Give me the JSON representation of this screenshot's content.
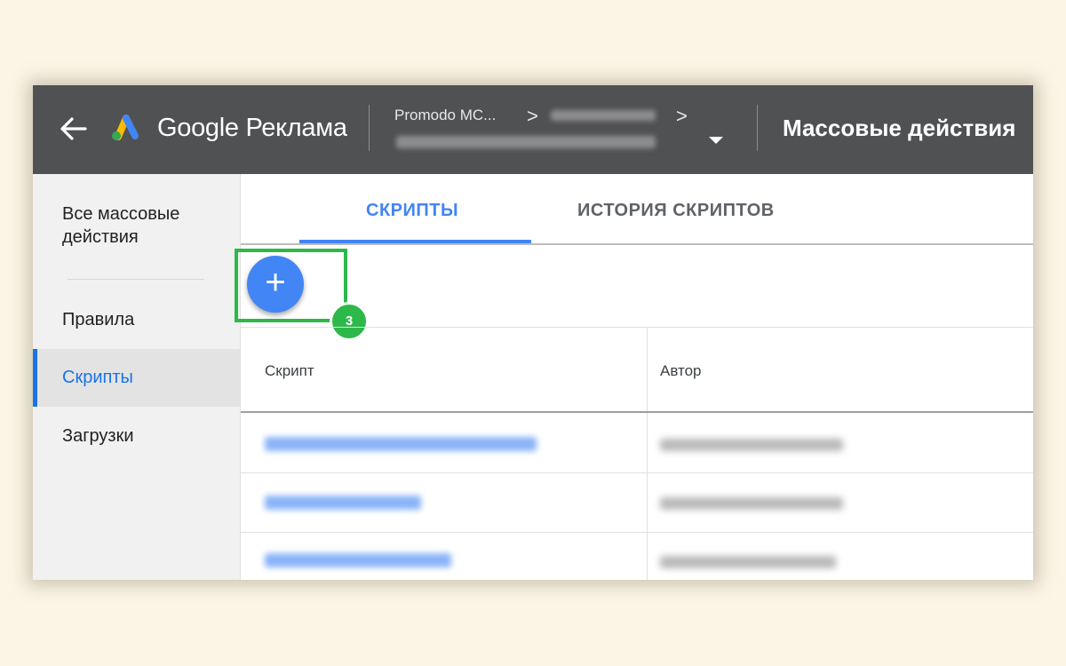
{
  "header": {
    "brand": "Google Реклама",
    "account_name": "Promodo MC...",
    "breadcrumb_separator": ">",
    "page_title": "Массовые действия"
  },
  "sidebar": {
    "items": [
      {
        "label": "Все массовые действия"
      },
      {
        "label": "Правила"
      },
      {
        "label": "Скрипты",
        "active": true
      },
      {
        "label": "Загрузки"
      }
    ]
  },
  "tabs": [
    {
      "label": "СКРИПТЫ",
      "active": true
    },
    {
      "label": "ИСТОРИЯ СКРИПТОВ",
      "active": false
    }
  ],
  "toolbar": {
    "add_label": "+",
    "step_number": "3"
  },
  "table": {
    "columns": [
      "Скрипт",
      "Автор"
    ]
  },
  "colors": {
    "topbar": "#505153",
    "accent": "#4285f4",
    "highlight": "#2db84a",
    "background": "#fbf5e6"
  },
  "icons": [
    "back-arrow-icon",
    "google-ads-logo-icon",
    "dropdown-icon",
    "add-icon"
  ]
}
